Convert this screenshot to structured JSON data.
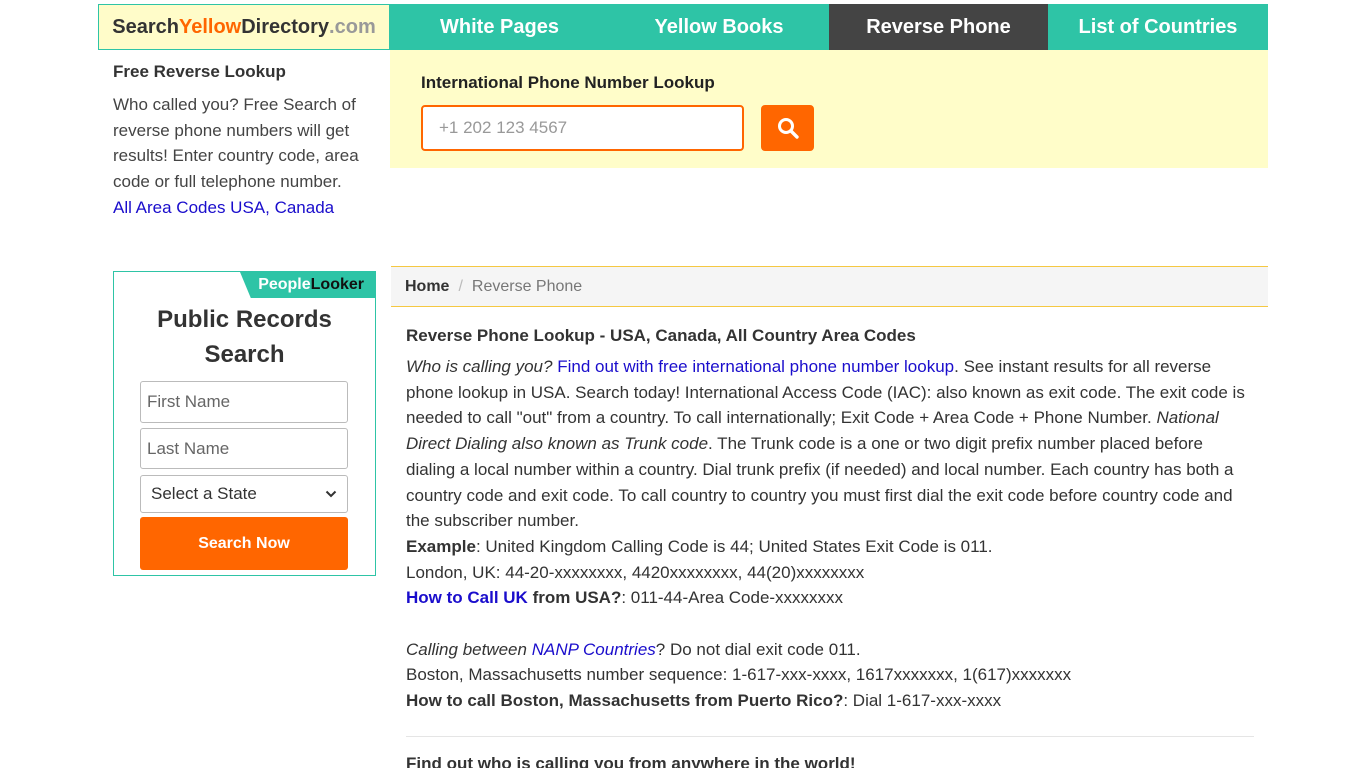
{
  "logo": {
    "part1": "Search",
    "part2": "Yellow",
    "part3": "Directory",
    "part4": ".com"
  },
  "nav": [
    {
      "label": "White Pages"
    },
    {
      "label": "Yellow Books"
    },
    {
      "label": "Reverse Phone"
    },
    {
      "label": "List of Countries"
    }
  ],
  "intro": {
    "title": "Free Reverse Lookup",
    "text": "Who called you? Free Search of reverse phone numbers will get results! Enter country code, area code or full telephone number.",
    "link": "All Area Codes USA, Canada"
  },
  "lookup": {
    "title": "International Phone Number Lookup",
    "placeholder": "+1 202 123 4567"
  },
  "widget": {
    "brand_part1": "People",
    "brand_part2": "Looker",
    "title": "Public Records Search",
    "first_name_placeholder": "First Name",
    "last_name_placeholder": "Last Name",
    "state_selected": "Select a State",
    "button": "Search Now"
  },
  "breadcrumb": {
    "home": "Home",
    "separator": "/",
    "current": "Reverse Phone"
  },
  "article": {
    "title": "Reverse Phone Lookup - USA, Canada, All Country Area Codes",
    "p1_italic": "Who is calling you?",
    "p1_link": "Find out with free international phone number lookup",
    "p1_text1": ". See instant results for all reverse phone lookup in USA. Search today! International Access Code (IAC): also known as exit code. The exit code is needed to call \"out\" from a country. To call internationally; Exit Code + Area Code + Phone Number.",
    "p1_italic2": "National Direct Dialing also known as Trunk code",
    "p1_text2": ". The Trunk code is a one or two digit prefix number placed before dialing a local number within a country. Dial trunk prefix (if needed) and local number. Each country has both a country code and exit code. To call country to country you must first dial the exit code before country code and the subscriber number.",
    "example_label": "Example",
    "example_text": ": United Kingdom Calling Code is 44; United States Exit Code is 011.",
    "london_line": "London, UK: 44-20-xxxxxxxx, 4420xxxxxxxx, 44(20)xxxxxxxx",
    "uk_link": "How to Call UK",
    "uk_bold": " from USA?",
    "uk_text": ": 011-44-Area Code-xxxxxxxx",
    "nanp_italic1": "Calling between",
    "nanp_link": "NANP Countries",
    "nanp_text": "? Do not dial exit code 011.",
    "boston_line": "Boston, Massachusetts number sequence: 1-617-xxx-xxxx, 1617xxxxxxx, 1(617)xxxxxxx",
    "pr_bold": "How to call Boston, Massachusetts from Puerto Rico?",
    "pr_text": ": Dial 1-617-xxx-xxxx",
    "subheading": "Find out who is calling you from anywhere in the world!"
  },
  "colors": {
    "teal": "#2ec4a6",
    "orange": "#ff6600",
    "yellow_bg": "#fffdc9",
    "active_nav": "#444444",
    "link": "#1a0dcc"
  }
}
